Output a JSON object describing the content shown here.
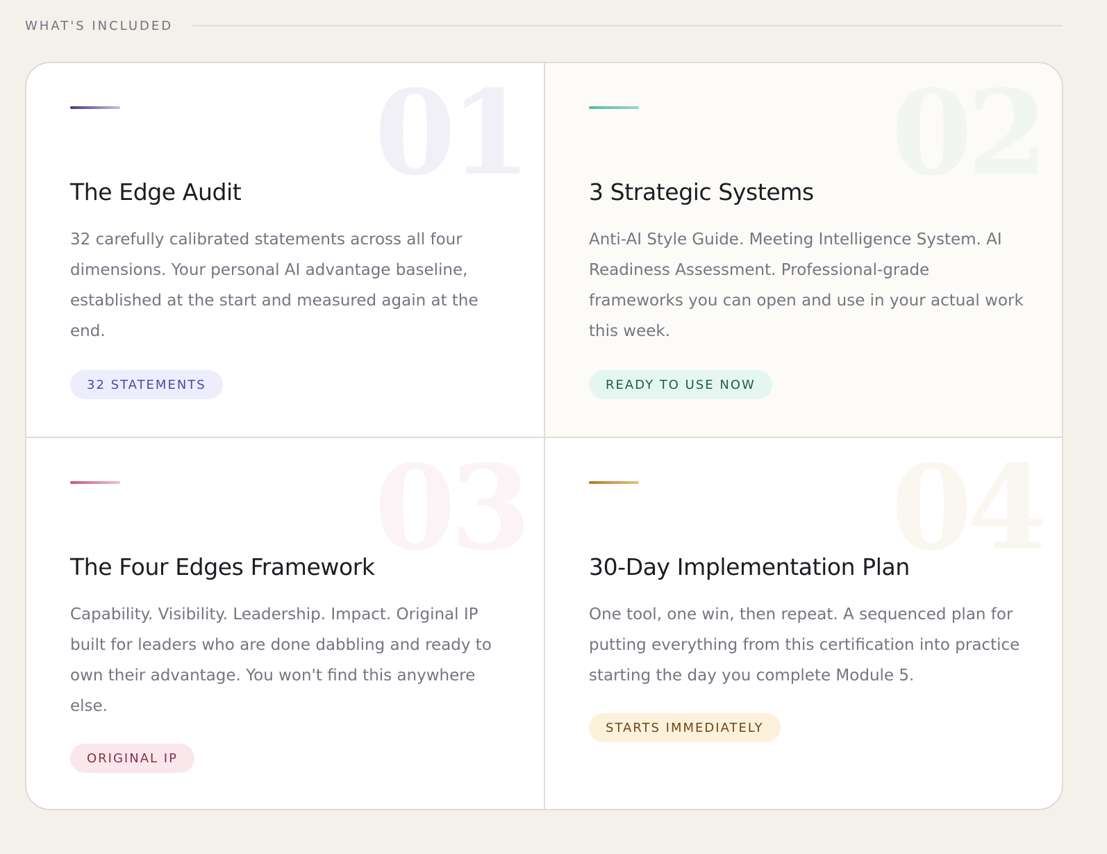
{
  "header": {
    "label": "WHAT'S INCLUDED"
  },
  "cards": [
    {
      "number": "01",
      "title": "The Edge Audit",
      "body": "32 carefully calibrated statements across all four dimensions. Your personal AI advantage baseline, established at the start and measured again at the end.",
      "badge": "32 STATEMENTS",
      "accent_from": "#433d8a",
      "accent_to": "#c5c1e6",
      "number_color": "#f1f0f7",
      "badge_bg": "#eeedfd",
      "badge_text": "#4f46a5"
    },
    {
      "number": "02",
      "title": "3 Strategic Systems",
      "body": "Anti-AI Style Guide. Meeting Intelligence System. AI Readiness Assessment. Professional-grade frameworks you can open and use in your actual work this week.",
      "badge": "READY TO USE NOW",
      "accent_from": "#5cb8aa",
      "accent_to": "#9ad6cb",
      "number_color": "#f1f6f3",
      "badge_bg": "#e5f6f1",
      "badge_text": "#1f5e4e"
    },
    {
      "number": "03",
      "title": "The Four Edges Framework",
      "body": "Capability. Visibility. Leadership. Impact. Original IP built for leaders who are done dabbling and ready to own their advantage. You won't find this anywhere else.",
      "badge": "ORIGINAL IP",
      "accent_from": "#c4587e",
      "accent_to": "#efc1d0",
      "number_color": "#fbf3f5",
      "badge_bg": "#f9e7ec",
      "badge_text": "#8c2d4b"
    },
    {
      "number": "04",
      "title": "30-Day Implementation Plan",
      "body": "One tool, one win, then repeat. A sequenced plan for putting everything from this certification into practice starting the day you complete Module 5.",
      "badge": "STARTS IMMEDIATELY",
      "accent_from": "#b07a2e",
      "accent_to": "#e8c27d",
      "number_color": "#faf7f0",
      "badge_bg": "#fcf1da",
      "badge_text": "#6c4716"
    }
  ]
}
